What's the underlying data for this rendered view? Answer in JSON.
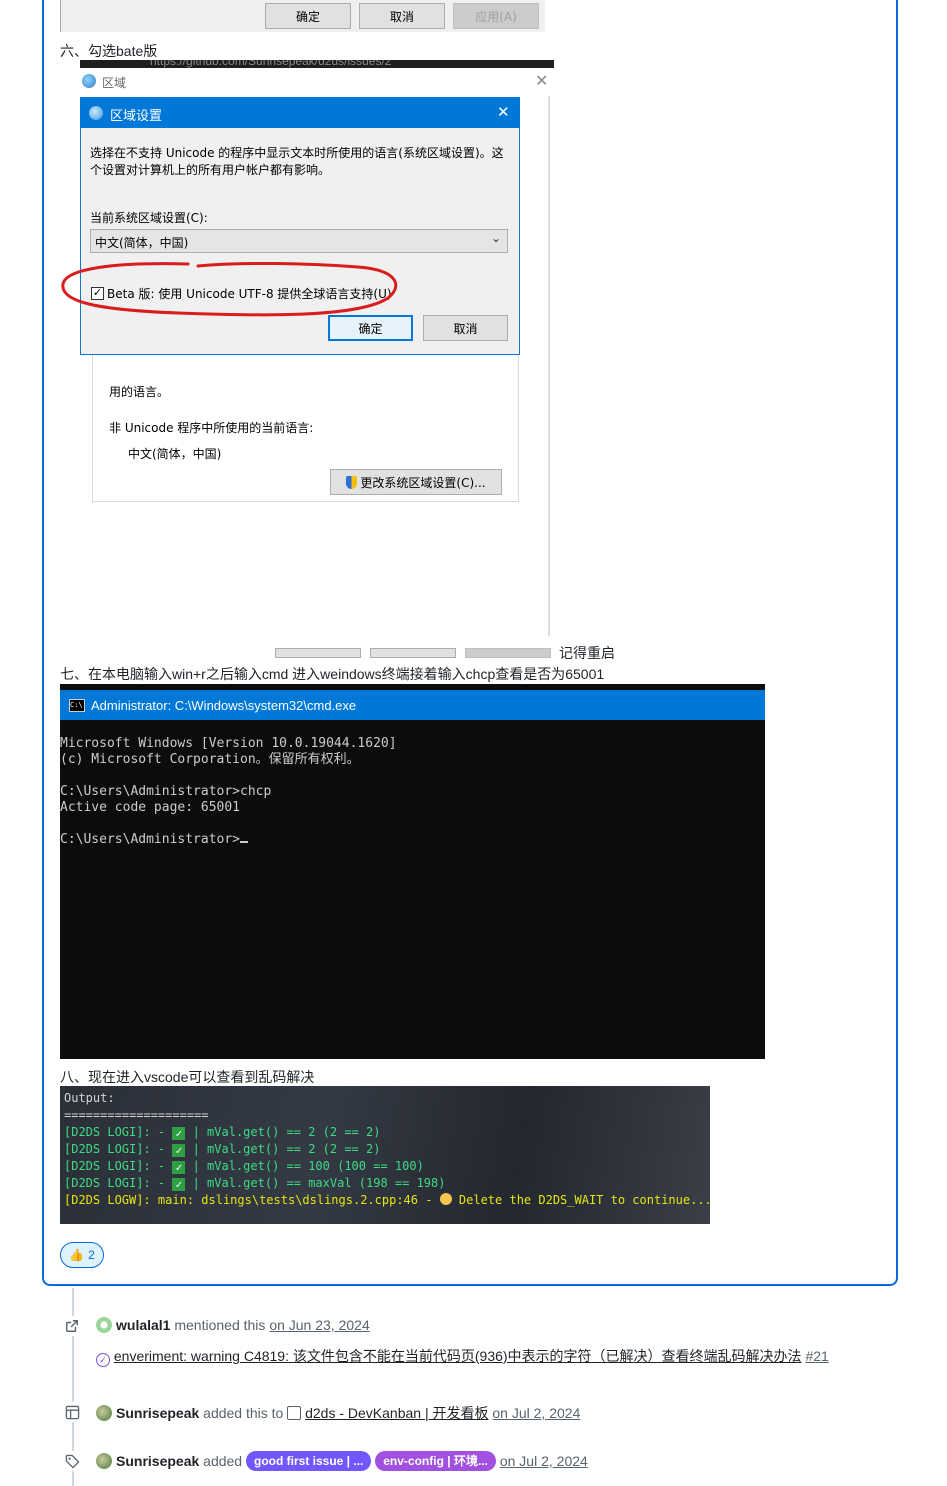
{
  "top_dialog": {
    "ok": "确定",
    "cancel": "取消",
    "apply": "应用(A)"
  },
  "steps": {
    "six": "六、勾选bate版",
    "seven": "七、在本电脑输入win+r之后输入cmd 进入weindows终端接着输入chcp查看是否为65001",
    "eight": "八、现在进入vscode可以查看到乱码解决",
    "restart_note": "记得重启"
  },
  "behind_url": "https://github.com/Sunrisepeak/d2ds/issues/2",
  "region_window": {
    "title": "区域",
    "partial_text": "用的语言。",
    "non_unicode_label": "非 Unicode 程序中所使用的当前语言:",
    "current_lang": "中文(简体，中国)",
    "change_button": "更改系统区域设置(C)..."
  },
  "region_settings": {
    "title": "区域设置",
    "description_line1": "选择在不支持 Unicode 的程序中显示文本时所使用的语言(系统区域设置)。这",
    "description_line2": "个设置对计算机上的所有用户帐户都有影响。",
    "current_label": "当前系统区域设置(C):",
    "current_value": "中文(简体，中国)",
    "beta_label": "Beta 版: 使用 Unicode UTF-8 提供全球语言支持(U)",
    "ok": "确定",
    "cancel": "取消"
  },
  "terminal": {
    "title": "Administrator: C:\\Windows\\system32\\cmd.exe",
    "lines": [
      "Microsoft Windows [Version 10.0.19044.1620]",
      "(c) Microsoft Corporation。保留所有权利。",
      "",
      "C:\\Users\\Administrator>chcp",
      "Active code page: 65001",
      "",
      "C:\\Users\\Administrator>"
    ]
  },
  "vscode_output": {
    "header": "Output:",
    "divider": "====================",
    "logi_prefix": "[D2DS LOGI]: - ",
    "logi_lines": [
      " | mVal.get() == 2 (2 == 2)",
      " | mVal.get() == 2 (2 == 2)",
      " | mVal.get() == 100 (100 == 100)",
      " | mVal.get() == maxVal (198 == 198)"
    ],
    "logw_prefix": "[D2DS LOGW]: main: dslings\\tests\\dslings.2.cpp:46 - ",
    "logw_message": " Delete the D2DS_WAIT to continue..."
  },
  "reaction": {
    "emoji": "👍",
    "count": "2"
  },
  "timeline": [
    {
      "user": "wulalal1",
      "action": "mentioned this",
      "date": "on Jun 23, 2024",
      "ref_title": "enveriment: warning C4819: 该文件包含不能在当前代码页(936)中表示的字符（已解决）查看终端乱码解决办法",
      "ref_number": "#21"
    },
    {
      "user": "Sunrisepeak",
      "action": "added this to",
      "project": "d2ds - DevKanban | 开发看板",
      "date": "on Jul 2, 2024"
    },
    {
      "user": "Sunrisepeak",
      "action": "added",
      "labels": [
        {
          "text": "good first issue | ...",
          "color": "#7057ff"
        },
        {
          "text": "env-config | 环境...",
          "color": "#a150e0"
        }
      ],
      "date": "on Jul 2, 2024"
    }
  ]
}
